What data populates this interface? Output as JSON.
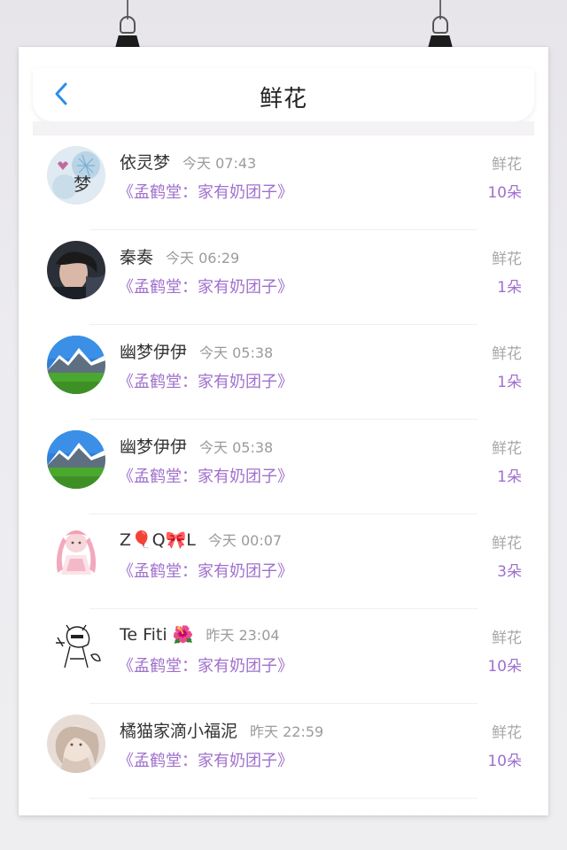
{
  "header": {
    "title": "鲜花"
  },
  "list": [
    {
      "name": "依灵梦",
      "time": "今天 07:43",
      "book": "《孟鹤堂：家有奶团子》",
      "gift": "鲜花",
      "count": "10朵"
    },
    {
      "name": "秦奏",
      "time": "今天 06:29",
      "book": "《孟鹤堂：家有奶团子》",
      "gift": "鲜花",
      "count": "1朵"
    },
    {
      "name": "幽梦伊伊",
      "time": "今天 05:38",
      "book": "《孟鹤堂：家有奶团子》",
      "gift": "鲜花",
      "count": "1朵"
    },
    {
      "name": "幽梦伊伊",
      "time": "今天 05:38",
      "book": "《孟鹤堂：家有奶团子》",
      "gift": "鲜花",
      "count": "1朵"
    },
    {
      "name": "Z🎈Q🎀L",
      "time": "今天 00:07",
      "book": "《孟鹤堂：家有奶团子》",
      "gift": "鲜花",
      "count": "3朵"
    },
    {
      "name": "Te Fiti 🌺",
      "time": "昨天 23:04",
      "book": "《孟鹤堂：家有奶团子》",
      "gift": "鲜花",
      "count": "10朵"
    },
    {
      "name": "橘猫家滴小福泥",
      "time": "昨天 22:59",
      "book": "《孟鹤堂：家有奶团子》",
      "gift": "鲜花",
      "count": "10朵"
    }
  ],
  "avatar_texts": {
    "first": "梦"
  },
  "colors": {
    "accent_purple": "#a070cc",
    "back_arrow_blue": "#2b8de8",
    "muted_gray": "#9b9b9b"
  }
}
